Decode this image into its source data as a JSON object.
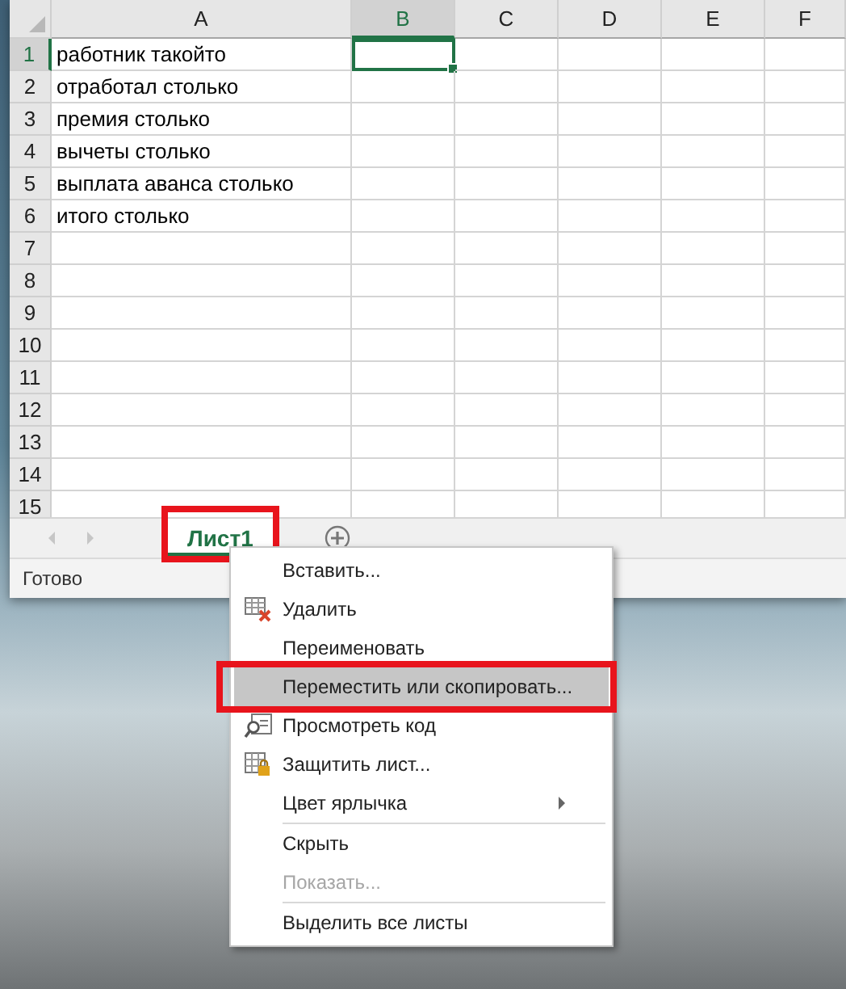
{
  "columns": [
    {
      "label": "A",
      "selected": false
    },
    {
      "label": "B",
      "selected": true
    },
    {
      "label": "C",
      "selected": false
    },
    {
      "label": "D",
      "selected": false
    },
    {
      "label": "E",
      "selected": false
    },
    {
      "label": "F",
      "selected": false
    }
  ],
  "rows": [
    {
      "number": "1",
      "selected": true,
      "cell_a": "работник такойто"
    },
    {
      "number": "2",
      "selected": false,
      "cell_a": "отработал столько"
    },
    {
      "number": "3",
      "selected": false,
      "cell_a": "премия столько"
    },
    {
      "number": "4",
      "selected": false,
      "cell_a": "вычеты столько"
    },
    {
      "number": "5",
      "selected": false,
      "cell_a": "выплата аванса столько"
    },
    {
      "number": "6",
      "selected": false,
      "cell_a": "итого столько"
    },
    {
      "number": "7",
      "selected": false
    },
    {
      "number": "8",
      "selected": false
    },
    {
      "number": "9",
      "selected": false
    },
    {
      "number": "10",
      "selected": false
    },
    {
      "number": "11",
      "selected": false
    },
    {
      "number": "12",
      "selected": false
    },
    {
      "number": "13",
      "selected": false
    },
    {
      "number": "14",
      "selected": false
    },
    {
      "number": "15",
      "selected": false
    }
  ],
  "sheet_tabs": [
    {
      "label": "Лист1",
      "selected": true,
      "highlighted": true
    }
  ],
  "status_bar": {
    "text": "Готово"
  },
  "context_menu": {
    "items": [
      {
        "kind": "command",
        "label": "Вставить...",
        "selected": false,
        "disabled": false,
        "highlighted": false
      },
      {
        "kind": "command",
        "label": "Удалить",
        "selected": false,
        "disabled": false,
        "highlighted": false
      },
      {
        "kind": "command",
        "label": "Переименовать",
        "selected": false,
        "disabled": false,
        "highlighted": false
      },
      {
        "kind": "command",
        "label": "Переместить или скопировать...",
        "selected": true,
        "disabled": false,
        "highlighted": true
      },
      {
        "kind": "command",
        "label": "Просмотреть код",
        "selected": false,
        "disabled": false,
        "highlighted": false
      },
      {
        "kind": "command",
        "label": "Защитить лист...",
        "selected": false,
        "disabled": false,
        "highlighted": false
      },
      {
        "kind": "submenu",
        "label": "Цвет ярлычка",
        "selected": false,
        "disabled": false,
        "highlighted": false
      },
      {
        "kind": "separator"
      },
      {
        "kind": "command",
        "label": "Скрыть",
        "selected": false,
        "disabled": false,
        "highlighted": false
      },
      {
        "kind": "command",
        "label": "Показать...",
        "selected": false,
        "disabled": true,
        "highlighted": false
      },
      {
        "kind": "separator"
      },
      {
        "kind": "command",
        "label": "Выделить все листы",
        "selected": false,
        "disabled": false,
        "highlighted": false
      }
    ]
  }
}
